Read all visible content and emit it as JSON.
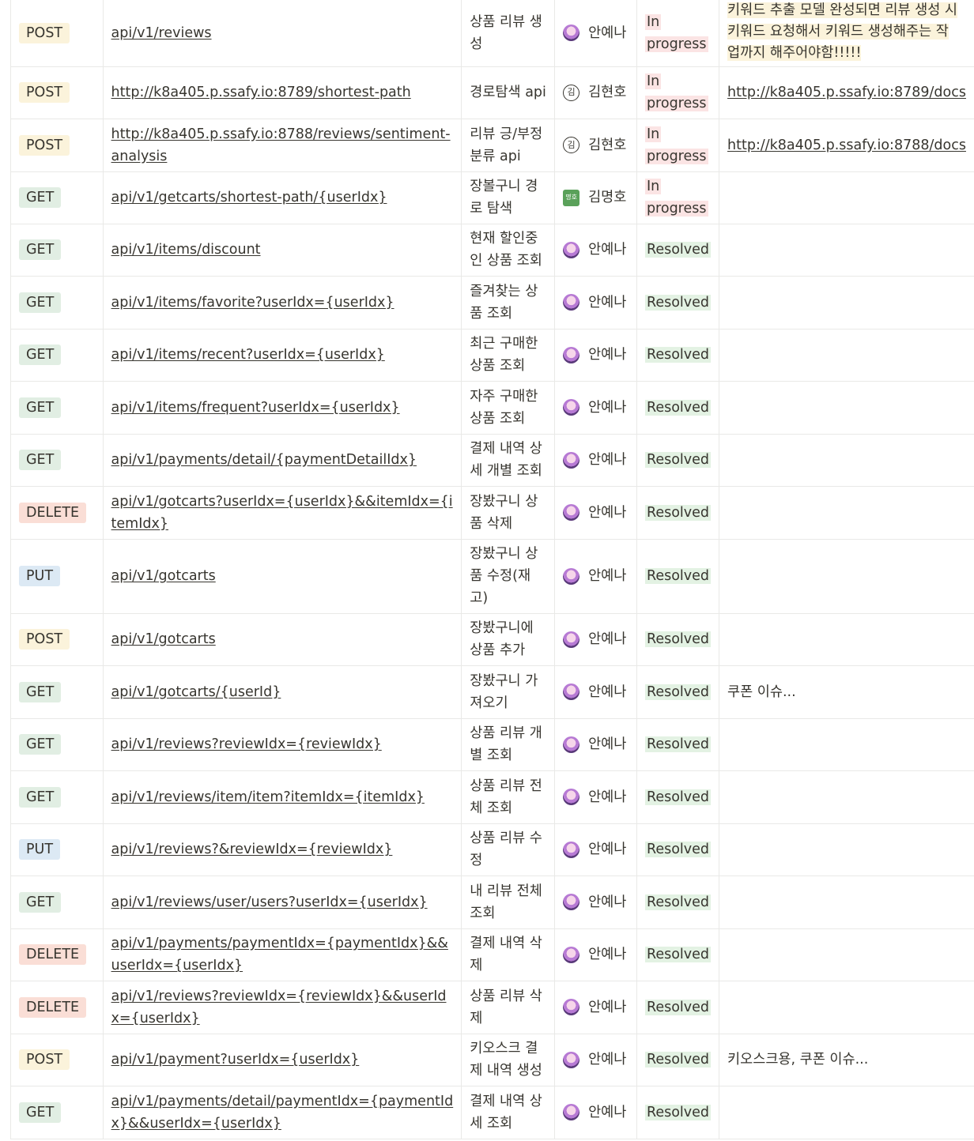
{
  "rows": [
    {
      "method": "POST",
      "url": "api/v1/reviews",
      "desc": "상품 리뷰 생성",
      "assignee": "안예나",
      "avatar": "anime",
      "status": "In progress",
      "note": [
        "키워드 추출 모델 완성되면 리뷰 생성 시",
        "키워드 요청해서 키워드 생성해주는 작",
        "업까지 해주어야함!!!!!"
      ],
      "note_highlight": true
    },
    {
      "method": "POST",
      "url": "http://k8a405.p.ssafy.io:8789/shortest-path",
      "desc": "경로탐색 api",
      "assignee": "김현호",
      "avatar": "letter",
      "avatar_text": "김",
      "status": "In progress",
      "note_link": "http://k8a405.p.ssafy.io:8789/docs"
    },
    {
      "method": "POST",
      "url": "http://k8a405.p.ssafy.io:8788/reviews/sentiment-analysis",
      "desc": "리뷰 긍/부정 분류 api",
      "assignee": "김현호",
      "avatar": "letter",
      "avatar_text": "김",
      "status": "In progress",
      "note_link": "http://k8a405.p.ssafy.io:8788/docs"
    },
    {
      "method": "GET",
      "url": "api/v1/getcarts/shortest-path/{userIdx}",
      "desc": "장볼구니 경로 탐색",
      "assignee": "김명호",
      "avatar": "green",
      "avatar_text": "명호",
      "status": "In progress"
    },
    {
      "method": "GET",
      "url": "api/v1/items/discount",
      "desc": "현재 할인중인 상품 조회",
      "assignee": "안예나",
      "avatar": "anime",
      "status": "Resolved"
    },
    {
      "method": "GET",
      "url": "api/v1/items/favorite?userIdx={userIdx}",
      "desc": "즐겨찾는 상품 조회",
      "assignee": "안예나",
      "avatar": "anime",
      "status": "Resolved"
    },
    {
      "method": "GET",
      "url": "api/v1/items/recent?userIdx={userIdx}",
      "desc": "최근 구매한 상품 조회",
      "assignee": "안예나",
      "avatar": "anime",
      "status": "Resolved"
    },
    {
      "method": "GET",
      "url": "api/v1/items/frequent?userIdx={userIdx}",
      "desc": "자주 구매한 상품 조회",
      "assignee": "안예나",
      "avatar": "anime",
      "status": "Resolved"
    },
    {
      "method": "GET",
      "url": "api/v1/payments/detail/{paymentDetailIdx}",
      "desc": "결제 내역 상세 개별 조회",
      "assignee": "안예나",
      "avatar": "anime",
      "status": "Resolved"
    },
    {
      "method": "DELETE",
      "url": "api/v1/gotcarts?userIdx={userIdx}&&itemIdx={itemIdx}",
      "desc": "장봤구니 상품 삭제",
      "assignee": "안예나",
      "avatar": "anime",
      "status": "Resolved"
    },
    {
      "method": "PUT",
      "url": "api/v1/gotcarts",
      "desc": "장봤구니 상품 수정(재고)",
      "assignee": "안예나",
      "avatar": "anime",
      "status": "Resolved"
    },
    {
      "method": "POST",
      "url": "api/v1/gotcarts",
      "desc": "장봤구니에 상품 추가",
      "assignee": "안예나",
      "avatar": "anime",
      "status": "Resolved"
    },
    {
      "method": "GET",
      "url": "api/v1/gotcarts/{userId}",
      "desc": "장봤구니 가져오기",
      "assignee": "안예나",
      "avatar": "anime",
      "status": "Resolved",
      "note": [
        "쿠폰 이슈..."
      ]
    },
    {
      "method": "GET",
      "url": "api/v1/reviews?reviewIdx={reviewIdx}",
      "desc": "상품 리뷰 개별 조회",
      "assignee": "안예나",
      "avatar": "anime",
      "status": "Resolved"
    },
    {
      "method": "GET",
      "url": "api/v1/reviews/item/item?itemIdx={itemIdx}",
      "desc": "상품 리뷰 전체 조회",
      "assignee": "안예나",
      "avatar": "anime",
      "status": "Resolved"
    },
    {
      "method": "PUT",
      "url": "api/v1/reviews?&reviewIdx={reviewIdx}",
      "desc": "상품 리뷰 수정",
      "assignee": "안예나",
      "avatar": "anime",
      "status": "Resolved"
    },
    {
      "method": "GET",
      "url": "api/v1/reviews/user/users?userIdx={userIdx}",
      "desc": "내 리뷰 전체 조회",
      "assignee": "안예나",
      "avatar": "anime",
      "status": "Resolved"
    },
    {
      "method": "DELETE",
      "url": "api/v1/payments/paymentIdx={paymentIdx}&&userIdx={userIdx}",
      "desc": "결제 내역 삭제",
      "assignee": "안예나",
      "avatar": "anime",
      "status": "Resolved"
    },
    {
      "method": "DELETE",
      "url": "api/v1/reviews?reviewIdx={reviewIdx}&&userIdx={userIdx}",
      "desc": "상품 리뷰 삭제",
      "assignee": "안예나",
      "avatar": "anime",
      "status": "Resolved"
    },
    {
      "method": "POST",
      "url": "api/v1/payment?userIdx={userIdx}",
      "desc": "키오스크 결제 내역 생성",
      "assignee": "안예나",
      "avatar": "anime",
      "status": "Resolved",
      "note": [
        "키오스크용, 쿠폰 이슈..."
      ]
    },
    {
      "method": "GET",
      "url": "api/v1/payments/detail/paymentIdx={paymentIdx}&&userIdx={userIdx}",
      "desc": "결제 내역 상세 조회",
      "assignee": "안예나",
      "avatar": "anime",
      "status": "Resolved"
    }
  ]
}
